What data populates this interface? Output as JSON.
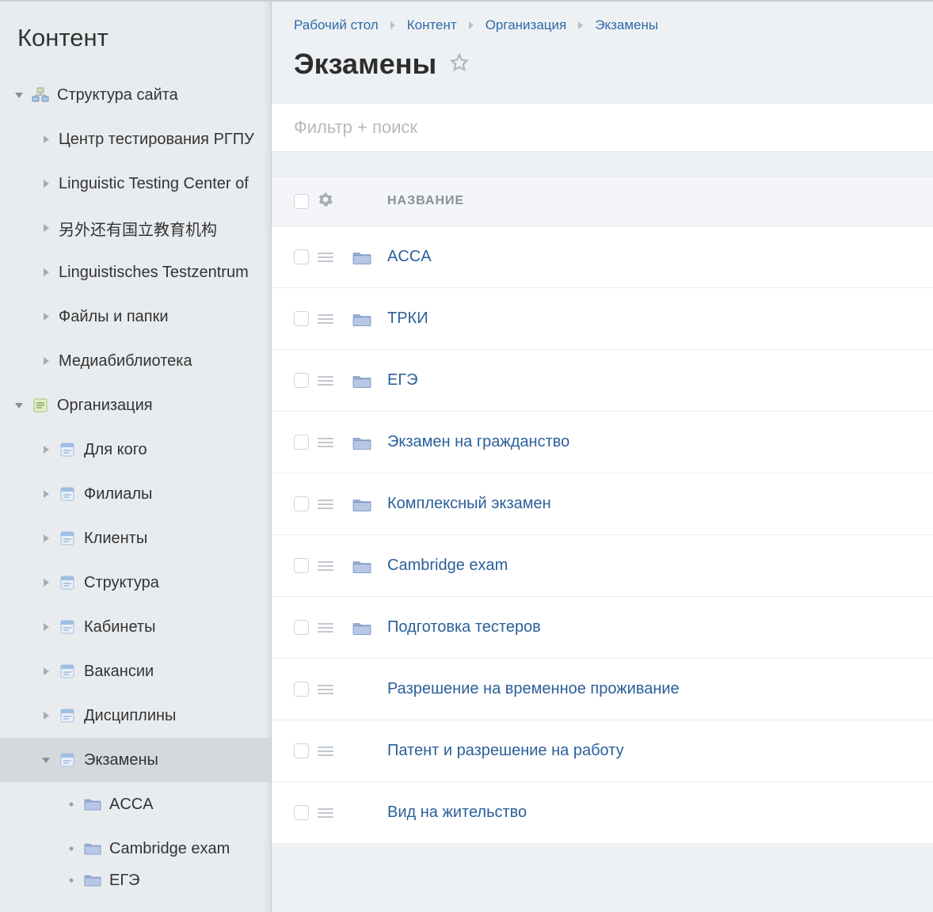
{
  "sidebar": {
    "title": "Контент",
    "groups": [
      {
        "expanded": true,
        "icon": "sitemap",
        "label": "Структура сайта",
        "children": [
          {
            "icon": "none",
            "label": "Центр тестирования РГПУ",
            "expanded": false
          },
          {
            "icon": "none",
            "label": "Linguistic Testing Center of",
            "expanded": false
          },
          {
            "icon": "none",
            "label": "另外还有国立教育机构",
            "expanded": false
          },
          {
            "icon": "none",
            "label": "Linguistisches Testzentrum",
            "expanded": false
          },
          {
            "icon": "none",
            "label": "Файлы и папки",
            "expanded": false
          },
          {
            "icon": "none",
            "label": "Медиабиблиотека",
            "expanded": false
          }
        ]
      },
      {
        "expanded": true,
        "icon": "page",
        "label": "Организация",
        "children": [
          {
            "icon": "doc",
            "label": "Для кого",
            "expanded": false
          },
          {
            "icon": "doc",
            "label": "Филиалы",
            "expanded": false
          },
          {
            "icon": "doc",
            "label": "Клиенты",
            "expanded": false
          },
          {
            "icon": "doc",
            "label": "Структура",
            "expanded": false
          },
          {
            "icon": "doc",
            "label": "Кабинеты",
            "expanded": false
          },
          {
            "icon": "doc",
            "label": "Вакансии",
            "expanded": false
          },
          {
            "icon": "doc",
            "label": "Дисциплины",
            "expanded": false
          },
          {
            "icon": "doc",
            "label": "Экзамены",
            "expanded": true,
            "selected": true,
            "children": [
              {
                "icon": "folder",
                "label": "ACCA"
              },
              {
                "icon": "folder",
                "label": "Cambridge exam"
              },
              {
                "icon": "folder",
                "label": "ЕГЭ",
                "cut": true
              }
            ]
          }
        ]
      }
    ]
  },
  "breadcrumb": {
    "items": [
      "Рабочий стол",
      "Контент",
      "Организация",
      "Экзамены"
    ]
  },
  "page": {
    "title": "Экзамены"
  },
  "filter": {
    "placeholder": "Фильтр + поиск"
  },
  "grid": {
    "header": {
      "name": "НАЗВАНИЕ"
    },
    "rows": [
      {
        "folder": true,
        "name": "ACCA"
      },
      {
        "folder": true,
        "name": "ТРКИ"
      },
      {
        "folder": true,
        "name": "ЕГЭ"
      },
      {
        "folder": true,
        "name": "Экзамен на гражданство"
      },
      {
        "folder": true,
        "name": "Комплексный экзамен"
      },
      {
        "folder": true,
        "name": "Cambridge exam"
      },
      {
        "folder": true,
        "name": "Подготовка тестеров"
      },
      {
        "folder": false,
        "name": "Разрешение на временное проживание"
      },
      {
        "folder": false,
        "name": "Патент и разрешение на работу"
      },
      {
        "folder": false,
        "name": "Вид на жительство"
      }
    ]
  }
}
